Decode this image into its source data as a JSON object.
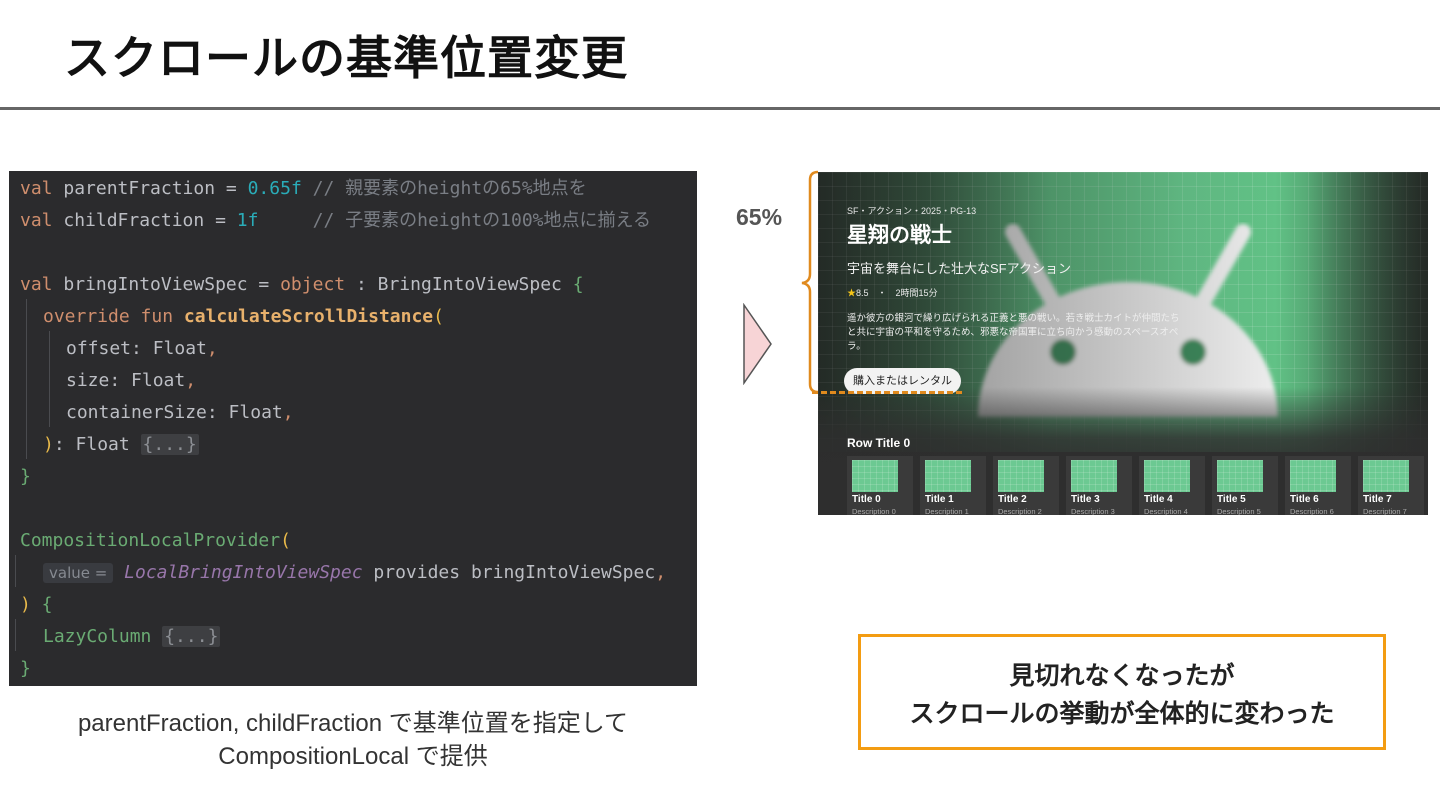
{
  "slide": {
    "title": "スクロールの基準位置変更"
  },
  "code": {
    "l1_kw": "val",
    "l1_name": " parentFraction = ",
    "l1_num": "0.65f",
    "l1_cmt": " // 親要素のheightの65%地点を",
    "l2_kw": "val",
    "l2_name": " childFraction = ",
    "l2_num": "1f",
    "l2_cmt": "     // 子要素のheightの100%地点に揃える",
    "l4_kw": "val",
    "l4_name": " bringIntoViewSpec = ",
    "l4_kw2": "object",
    "l4_type": " : BringIntoViewSpec ",
    "l4_brace": "{",
    "l5_kw": "override fun ",
    "l5_fn": "calculateScrollDistance",
    "l5_paren": "(",
    "l6_param": "offset: Float",
    "l7_param": "size: Float",
    "l8_param": "containerSize: Float",
    "comma": ",",
    "l9_paren": ")",
    "l9_ret": ": Float ",
    "fold": "{...}",
    "close_brace": "}",
    "l12_fn": "CompositionLocalProvider",
    "l12_paren": "(",
    "l13_hint": "value =",
    "l13_local": "LocalBringIntoViewSpec",
    "l13_rest": " provides bringIntoViewSpec",
    "l14_paren": ")",
    "l14_brace": " {",
    "l15_fn": "LazyColumn ",
    "l16_brace": "}"
  },
  "caption": {
    "line1": "parentFraction, childFraction で基準位置を指定して",
    "line2": "CompositionLocal で提供"
  },
  "annotation": {
    "percent": "65%"
  },
  "tv": {
    "meta": "SF・アクション・2025・PG-13",
    "title": "星翔の戦士",
    "subtitle": "宇宙を舞台にした壮大なSFアクション",
    "rating": "8.5",
    "duration": "・　2時間15分",
    "description": "遥か彼方の銀河で繰り広げられる正義と悪の戦い。若き戦士カイトが仲間たちと共に宇宙の平和を守るため、邪悪な帝国軍に立ち向かう感動のスペースオペラ。",
    "button": "購入またはレンタル",
    "row_title": "Row Title 0",
    "cards": [
      {
        "title": "Title 0",
        "desc": "Description 0"
      },
      {
        "title": "Title 1",
        "desc": "Description 1"
      },
      {
        "title": "Title 2",
        "desc": "Description 2"
      },
      {
        "title": "Title 3",
        "desc": "Description 3"
      },
      {
        "title": "Title 4",
        "desc": "Description 4"
      },
      {
        "title": "Title 5",
        "desc": "Description 5"
      },
      {
        "title": "Title 6",
        "desc": "Description 6"
      },
      {
        "title": "Title 7",
        "desc": "Description 7"
      }
    ]
  },
  "result": {
    "line1": "見切れなくなったが",
    "line2": "スクロールの挙動が全体的に変わった"
  },
  "colors": {
    "accent_orange": "#f39c12",
    "arrow_fill": "#f7d4d6",
    "code_bg": "#2b2b2d",
    "android_green": "#67c98d"
  }
}
